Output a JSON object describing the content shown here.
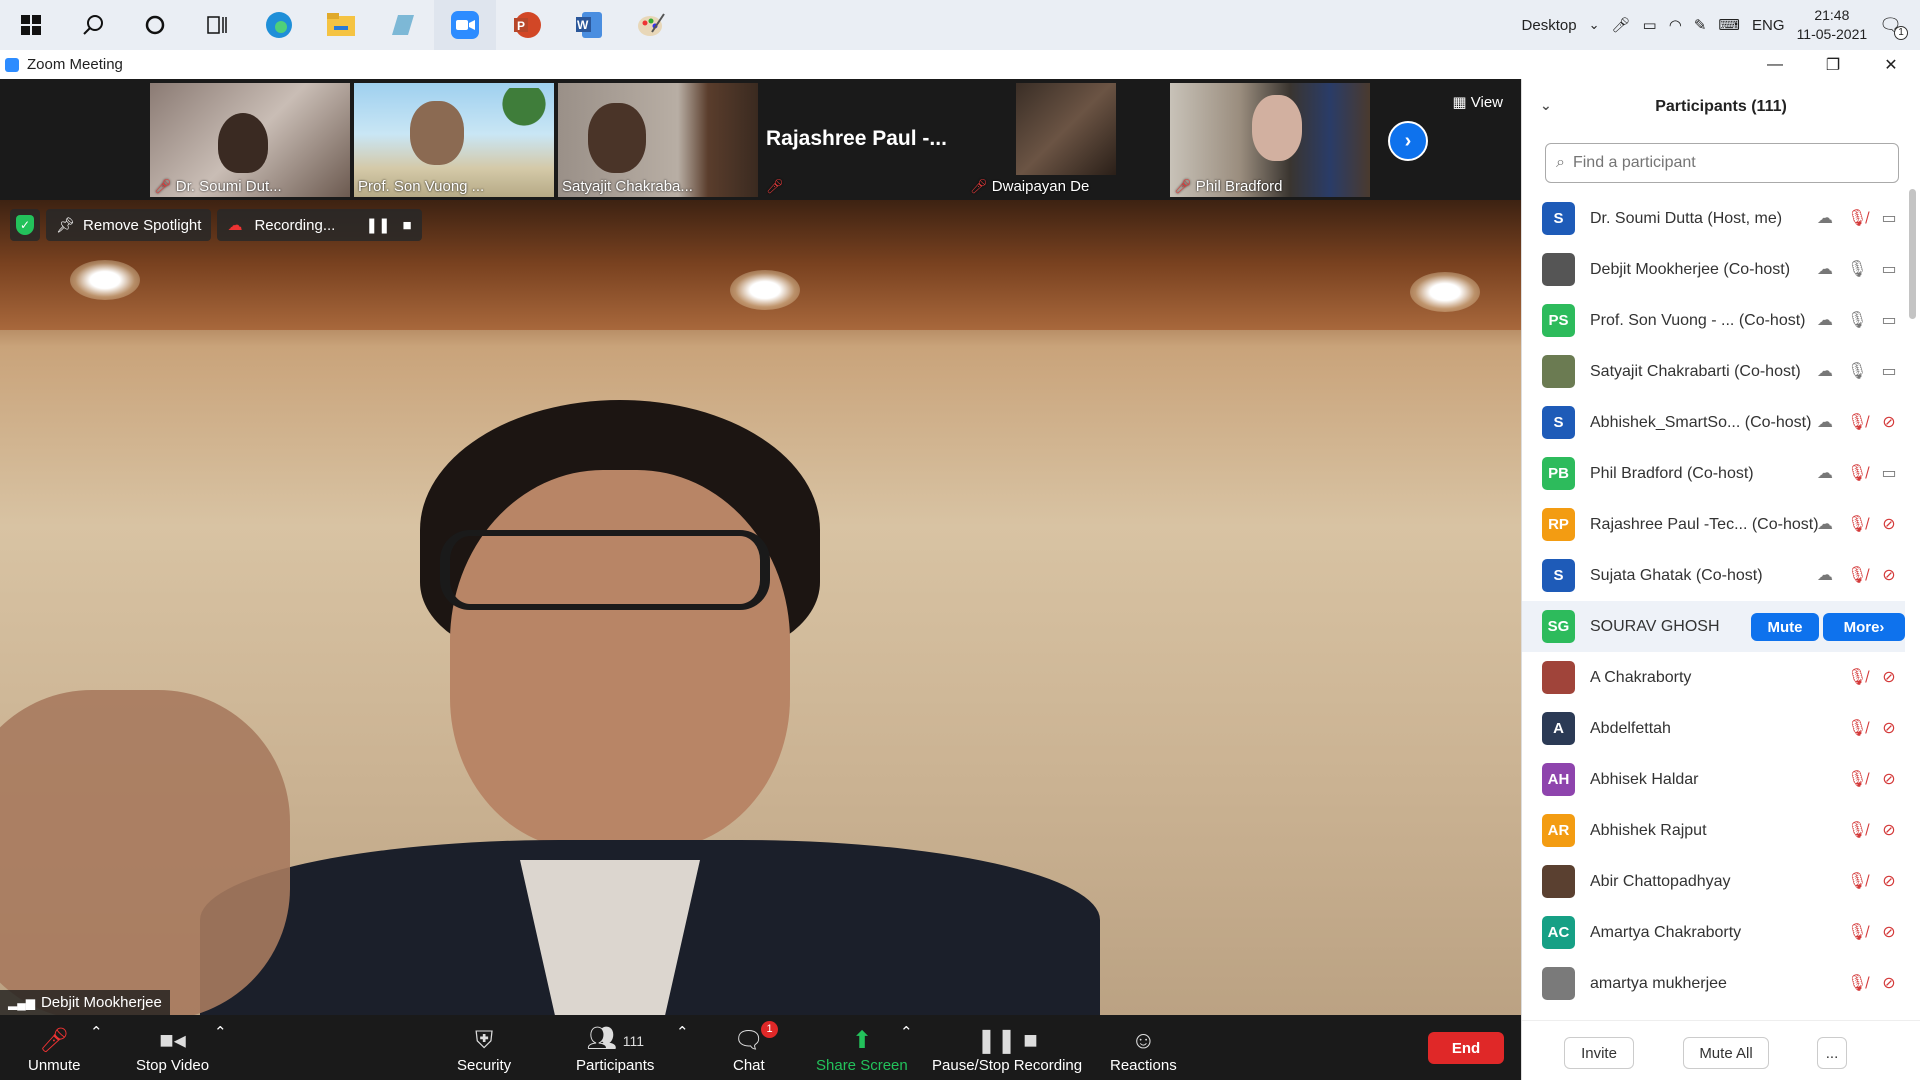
{
  "taskbar": {
    "apps": [
      "start-icon",
      "search-icon",
      "cortana-icon",
      "task-view-icon",
      "edge-icon",
      "file-explorer-icon",
      "app-icon",
      "zoom-icon",
      "powerpoint-icon",
      "word-icon",
      "paint-icon"
    ],
    "desktop_label": "Desktop",
    "lang": "ENG",
    "time": "21:48",
    "date": "11-05-2021",
    "notification_count": "1"
  },
  "window": {
    "title": "Zoom Meeting"
  },
  "strip": {
    "view_label": "View",
    "thumbs": [
      {
        "name": "Dr. Soumi Dut..."
      },
      {
        "name": "Prof. Son Vuong ..."
      },
      {
        "name": "Satyajit Chakraba..."
      },
      {
        "name": "Rajashree  Paul  -..."
      },
      {
        "name": "Dwaipayan De"
      },
      {
        "name": "Phil Bradford"
      }
    ]
  },
  "spotlight": {
    "remove_label": "Remove Spotlight",
    "recording_label": "Recording..."
  },
  "main": {
    "speaker_name": "Debjit Mookherjee"
  },
  "toolbar": {
    "unmute": "Unmute",
    "stop_video": "Stop Video",
    "security": "Security",
    "participants": "Participants",
    "participants_count": "111",
    "chat": "Chat",
    "chat_badge": "1",
    "share_screen": "Share Screen",
    "pause_stop": "Pause/Stop Recording",
    "reactions": "Reactions",
    "end": "End"
  },
  "panel": {
    "title": "Participants (111)",
    "search_placeholder": "Find a participant",
    "invite": "Invite",
    "mute_all": "Mute All",
    "more": "...",
    "row_mute": "Mute",
    "row_more": "More",
    "participants": [
      {
        "name": "Dr. Soumi Dutta (Host, me)",
        "initials": "S",
        "color": "#1e5bb8",
        "mic": "off",
        "video": "on",
        "cloud": true
      },
      {
        "name": "Debjit Mookherjee (Co-host)",
        "initials": "",
        "color": "#555555",
        "mic": "on",
        "video": "on",
        "cloud": true,
        "photo": true
      },
      {
        "name": "Prof. Son Vuong - ...  (Co-host)",
        "initials": "PS",
        "color": "#2dbb5c",
        "mic": "on",
        "video": "on",
        "cloud": true
      },
      {
        "name": "Satyajit Chakrabarti (Co-host)",
        "initials": "",
        "color": "#6b7b52",
        "mic": "on",
        "video": "on",
        "cloud": true,
        "photo": true
      },
      {
        "name": "Abhishek_SmartSo...  (Co-host)",
        "initials": "S",
        "color": "#1e5bb8",
        "mic": "off",
        "video": "off",
        "cloud": true
      },
      {
        "name": "Phil Bradford (Co-host)",
        "initials": "PB",
        "color": "#2dbb5c",
        "mic": "off",
        "video": "on",
        "cloud": true
      },
      {
        "name": "Rajashree Paul -Tec...  (Co-host)",
        "initials": "RP",
        "color": "#f39c12",
        "mic": "off",
        "video": "off",
        "cloud": true
      },
      {
        "name": "Sujata Ghatak (Co-host)",
        "initials": "S",
        "color": "#1e5bb8",
        "mic": "off",
        "video": "off",
        "cloud": true
      },
      {
        "name": "SOURAV GHOSH",
        "initials": "SG",
        "color": "#2dbb5c",
        "hover": true
      },
      {
        "name": "A Chakraborty",
        "initials": "",
        "color": "#a0443a",
        "mic": "off",
        "video": "off",
        "photo": true
      },
      {
        "name": "Abdelfettah",
        "initials": "A",
        "color": "#2b3a55",
        "mic": "off",
        "video": "off"
      },
      {
        "name": "Abhisek Haldar",
        "initials": "AH",
        "color": "#8e44ad",
        "mic": "off",
        "video": "off"
      },
      {
        "name": "Abhishek Rajput",
        "initials": "AR",
        "color": "#f39c12",
        "mic": "off",
        "video": "off"
      },
      {
        "name": "Abir Chattopadhyay",
        "initials": "",
        "color": "#5a4030",
        "mic": "off",
        "video": "off",
        "photo": true
      },
      {
        "name": "Amartya Chakraborty",
        "initials": "AC",
        "color": "#16a085",
        "mic": "off",
        "video": "off"
      },
      {
        "name": "amartya mukherjee",
        "initials": "",
        "color": "#7a7a7a",
        "mic": "off",
        "video": "off",
        "photo": true
      }
    ]
  }
}
